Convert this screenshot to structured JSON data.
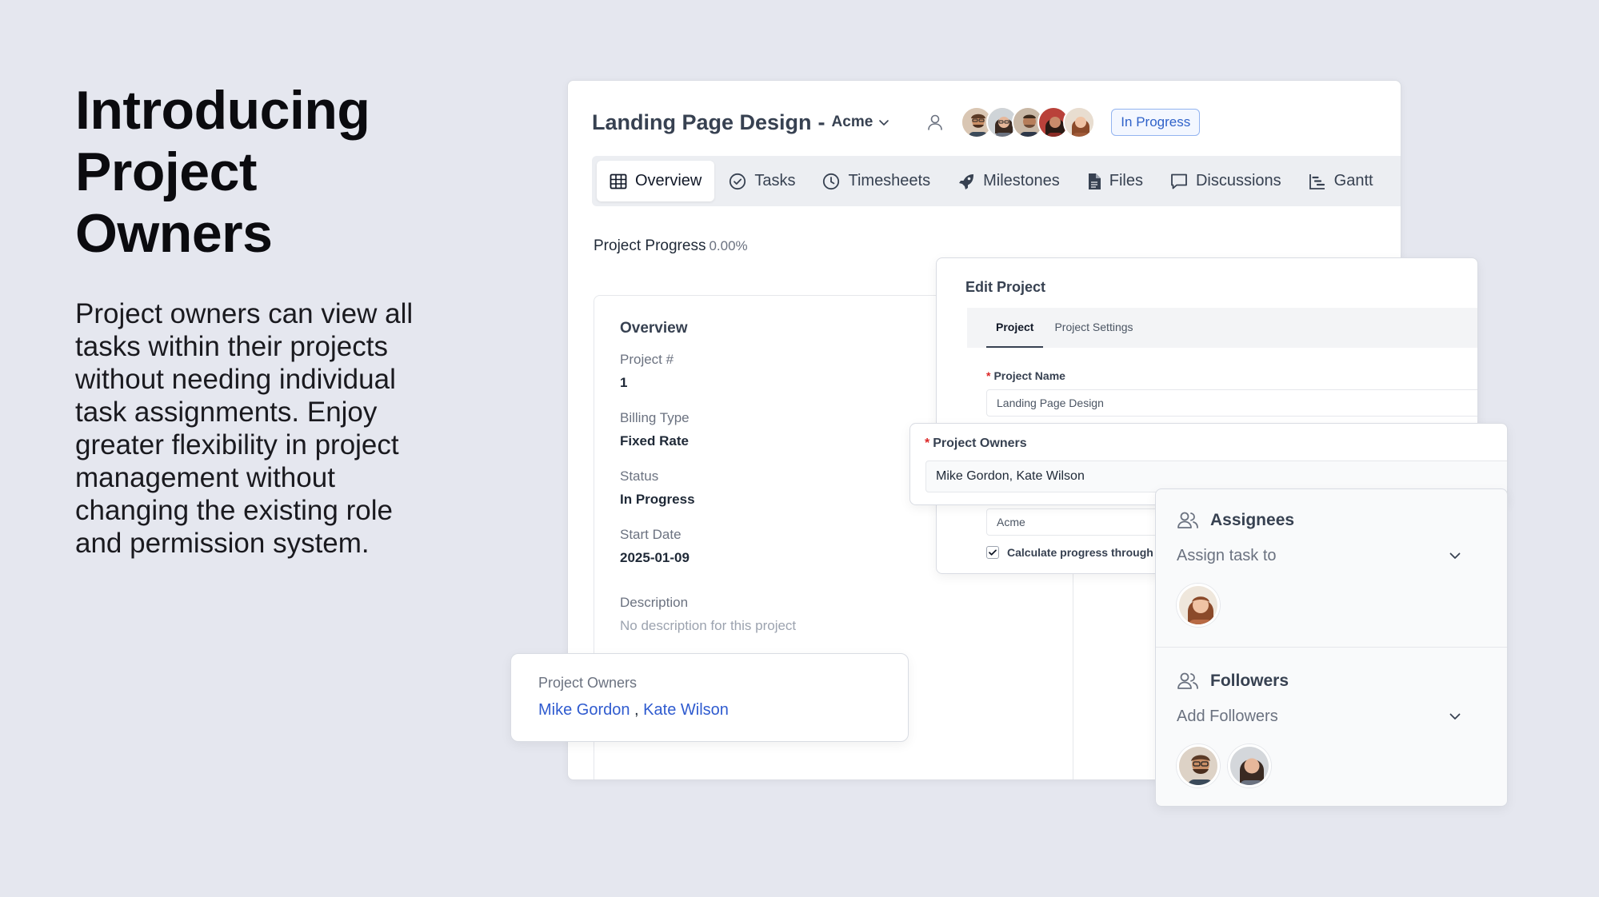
{
  "hero": {
    "title_line1": "Introducing",
    "title_line2": "Project",
    "title_line3": "Owners",
    "body": "Project owners can view all tasks within their projects without needing individual task assignments. Enjoy greater flexibility in project management without changing the existing role and permission system."
  },
  "project": {
    "title": "Landing Page Design",
    "dash": "-",
    "client": "Acme",
    "status": "In Progress",
    "avatars": [
      "avatar-1",
      "avatar-2",
      "avatar-3",
      "avatar-4",
      "avatar-5"
    ]
  },
  "tabs": [
    {
      "label": "Overview",
      "icon": "table-icon"
    },
    {
      "label": "Tasks",
      "icon": "check-circle-icon"
    },
    {
      "label": "Timesheets",
      "icon": "clock-icon"
    },
    {
      "label": "Milestones",
      "icon": "rocket-icon"
    },
    {
      "label": "Files",
      "icon": "file-icon"
    },
    {
      "label": "Discussions",
      "icon": "chat-icon"
    },
    {
      "label": "Gantt",
      "icon": "gantt-icon"
    }
  ],
  "progress": {
    "label": "Project Progress",
    "value": "0.00%"
  },
  "overview": {
    "title": "Overview",
    "fields": [
      {
        "label": "Project #",
        "value": "1"
      },
      {
        "label": "Billing Type",
        "value": "Fixed Rate"
      },
      {
        "label": "Status",
        "value": "In Progress"
      },
      {
        "label": "Start Date",
        "value": "2025-01-09"
      }
    ],
    "description_label": "Description",
    "description_value": "No description for this project"
  },
  "edit_dialog": {
    "title": "Edit Project",
    "tab_project": "Project",
    "tab_settings": "Project Settings",
    "name_required": "*",
    "name_label": "Project Name",
    "name_value": "Landing Page Design",
    "customer_value": "Acme",
    "calc_label": "Calculate progress through t"
  },
  "owners_popup": {
    "required": "*",
    "label": "Project Owners",
    "value": "Mike Gordon, Kate Wilson"
  },
  "side_panel": {
    "assignees_title": "Assignees",
    "assignees_placeholder": "Assign task to",
    "followers_title": "Followers",
    "followers_placeholder": "Add Followers"
  },
  "owners_card": {
    "label": "Project Owners",
    "owner1": "Mike Gordon",
    "separator": " , ",
    "owner2": "Kate Wilson"
  },
  "colors": {
    "background": "#e5e7ef",
    "accent_blue": "#2f5bcf",
    "status_blue": "#2f62c9",
    "required_red": "#dc2626"
  }
}
